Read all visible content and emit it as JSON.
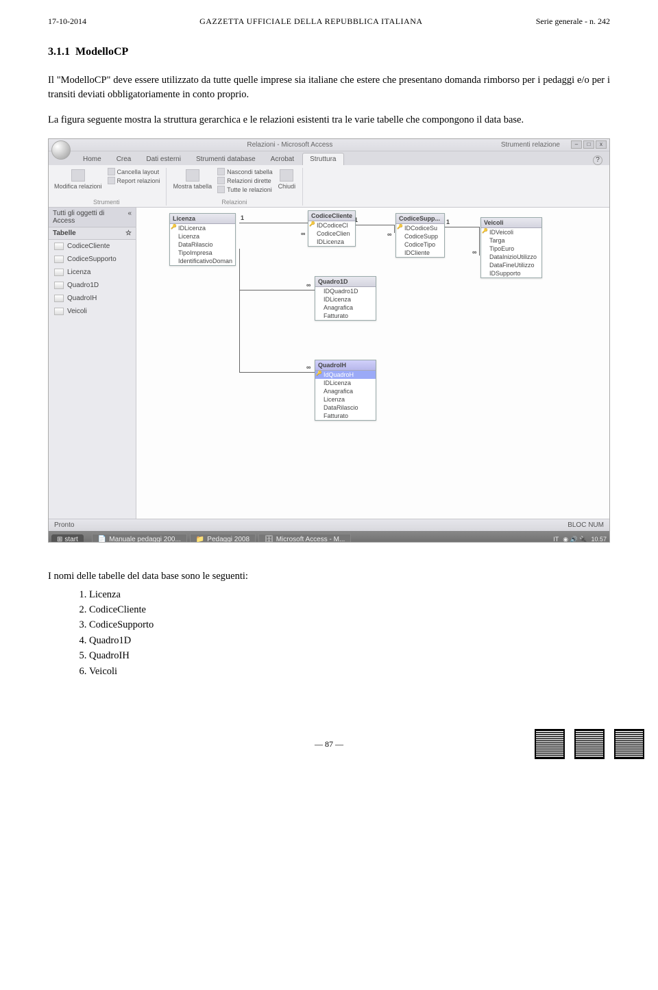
{
  "header": {
    "left": "17-10-2014",
    "center": "GAZZETTA UFFICIALE DELLA REPUBBLICA ITALIANA",
    "right": "Serie generale - n. 242"
  },
  "section": {
    "number": "3.1.1",
    "title": "ModelloCP"
  },
  "para1": "Il \"ModelloCP\" deve essere utilizzato da tutte quelle imprese sia italiane che estere che presentano domanda rimborso per i pedaggi e/o per i transiti deviati obbligatoriamente in conto proprio.",
  "para2": "La figura seguente mostra la struttura gerarchica e le relazioni esistenti tra le varie tabelle che compongono il data base.",
  "screenshot": {
    "titlebar": {
      "center": "Relazioni - Microsoft Access",
      "right": "Strumenti relazione"
    },
    "windowButtons": [
      "–",
      "□",
      "x",
      "–",
      "□",
      "x"
    ],
    "tabs": [
      "Home",
      "Crea",
      "Dati esterni",
      "Strumenti database",
      "Acrobat",
      "Struttura"
    ],
    "helpGlyph": "?",
    "ribbon": {
      "group1": {
        "btn": "Modifica relazioni",
        "items": [
          "Cancella layout",
          "Report relazioni"
        ],
        "label": "Strumenti"
      },
      "group2": {
        "btn1": "Mostra tabella",
        "items": [
          "Nascondi tabella",
          "Relazioni dirette",
          "Tutte le relazioni"
        ],
        "btn2": "Chiudi",
        "label": "Relazioni"
      }
    },
    "nav": {
      "head": "Tutti gli oggetti di Access",
      "chevrons": "«",
      "sub": "Tabelle",
      "subChevrons": "☆",
      "items": [
        "CodiceCliente",
        "CodiceSupporto",
        "Licenza",
        "Quadro1D",
        "QuadroIH",
        "Veicoli"
      ]
    },
    "tables": {
      "Licenza": {
        "title": "Licenza",
        "fields": [
          {
            "n": "IDLicenza",
            "k": true
          },
          {
            "n": "Licenza"
          },
          {
            "n": "DataRilascio"
          },
          {
            "n": "TipoImpresa"
          },
          {
            "n": "IdentificativoDoman"
          }
        ]
      },
      "CodiceCliente": {
        "title": "CodiceCliente",
        "fields": [
          {
            "n": "IDCodiceCl",
            "k": true
          },
          {
            "n": "CodiceClien"
          },
          {
            "n": "IDLicenza"
          }
        ]
      },
      "CodiceSupp": {
        "title": "CodiceSupp...",
        "fields": [
          {
            "n": "IDCodiceSu",
            "k": true
          },
          {
            "n": "CodiceSupp"
          },
          {
            "n": "CodiceTipo"
          },
          {
            "n": "IDCliente"
          }
        ]
      },
      "Veicoli": {
        "title": "Veicoli",
        "fields": [
          {
            "n": "IDVeicoli",
            "k": true
          },
          {
            "n": "Targa"
          },
          {
            "n": "TipoEuro"
          },
          {
            "n": "DataInizioUtilizzo"
          },
          {
            "n": "DataFineUtilizzo"
          },
          {
            "n": "IDSupporto"
          }
        ]
      },
      "Quadro1D": {
        "title": "Quadro1D",
        "fields": [
          {
            "n": "IDQuadro1D"
          },
          {
            "n": "IDLicenza"
          },
          {
            "n": "Anagrafica"
          },
          {
            "n": "Fatturato"
          }
        ]
      },
      "QuadroIH": {
        "title": "QuadroIH",
        "fields": [
          {
            "n": "IdQuadroH",
            "k": true,
            "sel": true
          },
          {
            "n": "IDLicenza"
          },
          {
            "n": "Anagrafica"
          },
          {
            "n": "Licenza"
          },
          {
            "n": "DataRilascio"
          },
          {
            "n": "Fatturato"
          }
        ]
      }
    },
    "relSymbols": {
      "one": "1",
      "many": "∞"
    },
    "status": {
      "left": "Pronto",
      "right": "BLOC NUM"
    },
    "taskbar": {
      "start": "start",
      "items": [
        "Manuale pedaggi 200...",
        "Pedaggi 2008",
        "Microsoft Access - M..."
      ],
      "lang": "IT",
      "time": "10.57"
    }
  },
  "list": {
    "intro": "I nomi delle tabelle del data base sono le seguenti:",
    "items": [
      "Licenza",
      "CodiceCliente",
      "CodiceSupporto",
      "Quadro1D",
      "QuadroIH",
      "Veicoli"
    ]
  },
  "footer": {
    "page": "— 87 —"
  }
}
